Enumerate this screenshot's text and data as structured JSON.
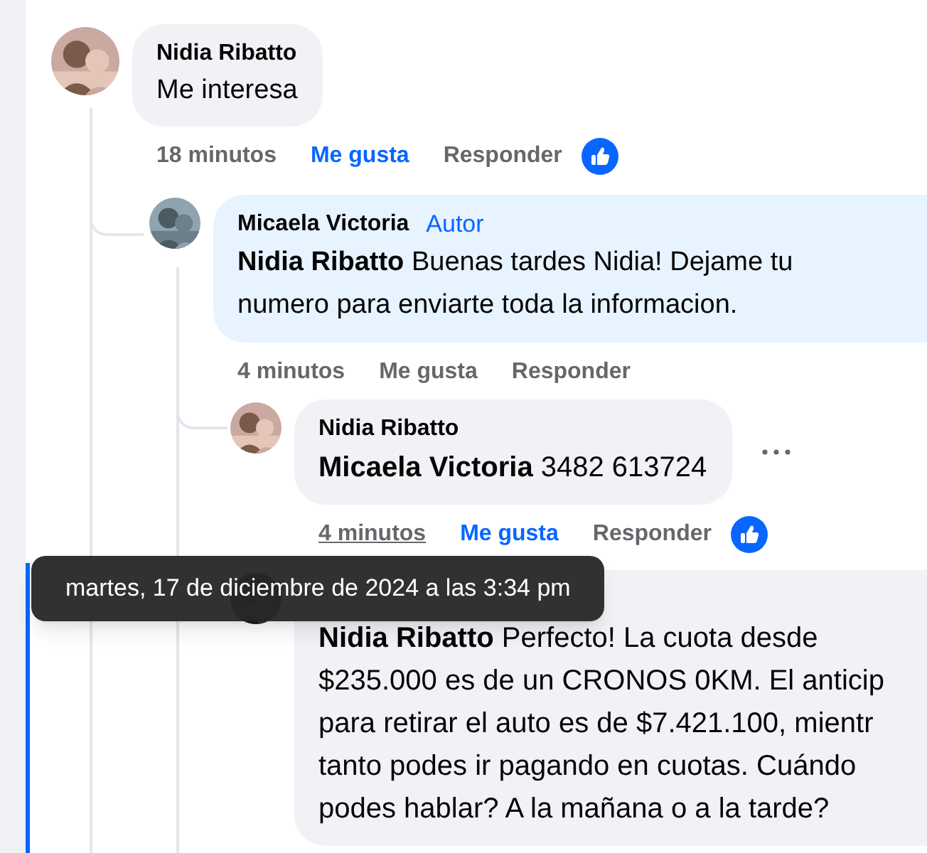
{
  "comments": [
    {
      "author": "Nidia Ribatto",
      "text_lines": [
        "Me interesa"
      ],
      "time": "18 minutos",
      "time_hovered": false,
      "like_label": "Me gusta",
      "liked": true,
      "reply_label": "Responder",
      "has_reaction": true,
      "children": [
        {
          "author": "Micaela Victoria",
          "badge": "Autor",
          "text_lines": [
            "**Nidia Ribatto** Buenas tardes Nidia! Dejame tu",
            "numero para enviarte toda la informacion."
          ],
          "highlighted": true,
          "time": "4 minutos",
          "time_hovered": false,
          "like_label": "Me gusta",
          "liked": false,
          "reply_label": "Responder",
          "children": [
            {
              "author": "Nidia Ribatto",
              "text_lines": [
                "**Micaela Victoria** 3482 613724"
              ],
              "time": "4 minutos",
              "time_hovered": true,
              "like_label": "Me gusta",
              "liked": true,
              "reply_label": "Responder",
              "has_reaction": true,
              "show_menu": true
            },
            {
              "text_lines": [
                "**Nidia Ribatto** Perfecto! La cuota desde",
                "$235.000 es de un CRONOS 0KM. El anticip",
                "para retirar el auto es de $7.421.100, mientr",
                "tanto podes ir pagando en cuotas. Cuándo",
                "podes hablar? A la mañana o a la tarde?"
              ],
              "focused": true
            }
          ]
        }
      ]
    }
  ],
  "tooltip": {
    "text": "martes, 17 de diciembre de 2024 a las 3:34 pm"
  }
}
